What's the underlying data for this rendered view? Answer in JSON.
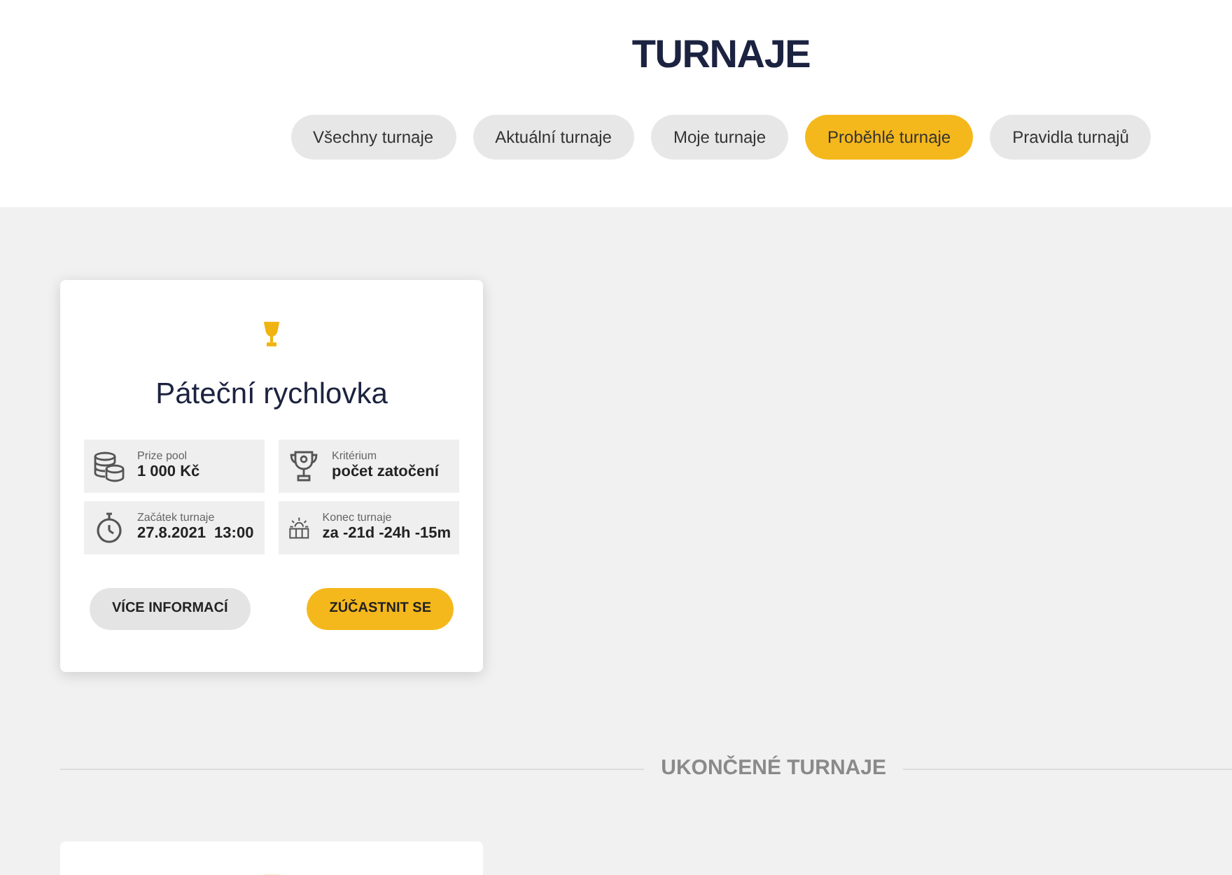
{
  "page_title": "TURNAJE",
  "tabs": [
    {
      "label": "Všechny turnaje",
      "selected": false
    },
    {
      "label": "Aktuální turnaje",
      "selected": false
    },
    {
      "label": "Moje turnaje",
      "selected": false
    },
    {
      "label": "Proběhlé turnaje",
      "selected": true
    },
    {
      "label": "Pravidla turnajů",
      "selected": false
    }
  ],
  "tournament_card": {
    "title": "Páteční rychlovka",
    "info": [
      {
        "label": "Prize pool",
        "value": "1 000 Kč"
      },
      {
        "label": "Kritérium",
        "value": "počet zatočení"
      },
      {
        "label": "Začátek turnaje",
        "value": "27.8.2021  13:00"
      },
      {
        "label": "Konec turnaje",
        "value": "za -21d -24h -15m"
      }
    ],
    "buttons": [
      {
        "label": "VÍCE INFORMACÍ",
        "kind": "secondary"
      },
      {
        "label": "ZÚČASTNIT SE",
        "kind": "primary"
      }
    ]
  },
  "section_heading": "UKONČENÉ TURNAJE"
}
